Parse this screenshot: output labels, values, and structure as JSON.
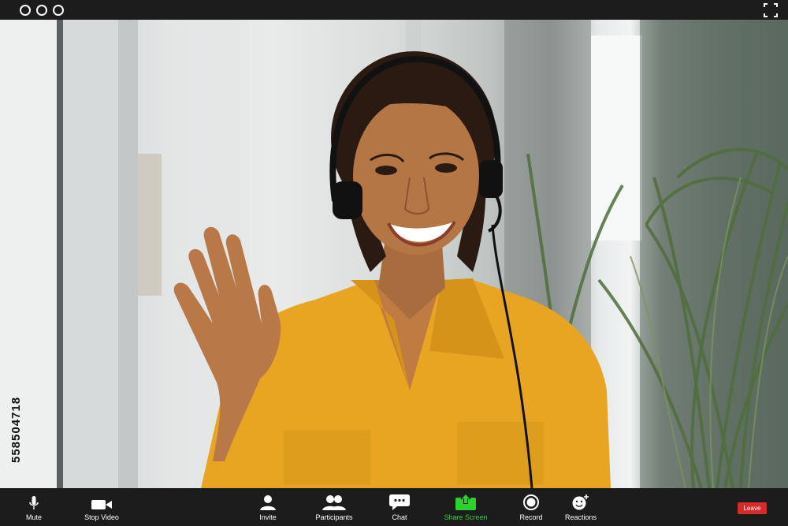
{
  "window": {
    "traffic_lights": [
      "circle",
      "circle",
      "circle"
    ],
    "fullscreen_icon": "fullscreen-icon"
  },
  "video": {
    "subject": "participant video feed",
    "side_text": "558504718"
  },
  "toolbar": {
    "mute_label": "Mute",
    "stop_video_label": "Stop Video",
    "invite_label": "Invite",
    "participants_label": "Participants",
    "chat_label": "Chat",
    "share_screen_label": "Share Screen",
    "record_label": "Record",
    "reactions_label": "Reactions",
    "leave_label": "Leave"
  },
  "colors": {
    "bar_bg": "#1c1c1c",
    "share_green": "#2dd02d",
    "leave_red": "#d62b2b",
    "shirt": "#e8a521"
  }
}
